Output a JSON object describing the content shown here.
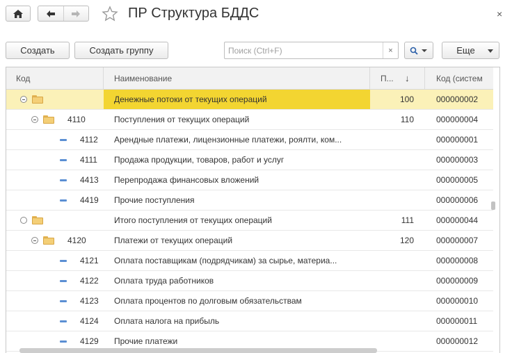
{
  "window": {
    "title": "ПР Структура БДДС",
    "close_label": "×"
  },
  "toolbar": {
    "create_label": "Создать",
    "create_group_label": "Создать группу",
    "search_placeholder": "Поиск (Ctrl+F)",
    "search_value": "",
    "clear_label": "×",
    "more_label": "Еще"
  },
  "table": {
    "columns": {
      "code": "Код",
      "name": "Наименование",
      "p": "П...",
      "sort_indicator": "↓",
      "system_code": "Код (систем"
    },
    "rows": [
      {
        "type": "group",
        "expander": "minus",
        "level": 0,
        "code": "",
        "name": "Денежные потоки от текущих операций",
        "p": "100",
        "system_code": "000000002",
        "selected": true
      },
      {
        "type": "group",
        "expander": "minus",
        "level": 1,
        "code": "4110",
        "name": "Поступления от текущих операций",
        "p": "110",
        "system_code": "000000004",
        "selected": false
      },
      {
        "type": "item",
        "level": 2,
        "code": "4112",
        "name": "Арендные платежи, лицензионные платежи, роялти, ком...",
        "p": "",
        "system_code": "000000001",
        "selected": false
      },
      {
        "type": "item",
        "level": 2,
        "code": "4111",
        "name": "Продажа продукции, товаров, работ и услуг",
        "p": "",
        "system_code": "000000003",
        "selected": false
      },
      {
        "type": "item",
        "level": 2,
        "code": "4413",
        "name": "Перепродажа финансовых вложений",
        "p": "",
        "system_code": "000000005",
        "selected": false
      },
      {
        "type": "item",
        "level": 2,
        "code": "4419",
        "name": "Прочие поступления",
        "p": "",
        "system_code": "000000006",
        "selected": false
      },
      {
        "type": "group",
        "expander": "empty",
        "level": 0,
        "code": "",
        "name": "Итого поступления от текущих операций",
        "p": "111",
        "system_code": "000000044",
        "selected": false
      },
      {
        "type": "group",
        "expander": "minus",
        "level": 1,
        "code": "4120",
        "name": "Платежи от текущих операций",
        "p": "120",
        "system_code": "000000007",
        "selected": false
      },
      {
        "type": "item",
        "level": 2,
        "code": "4121",
        "name": "Оплата поставщикам (подрядчикам) за сырье, материа...",
        "p": "",
        "system_code": "000000008",
        "selected": false
      },
      {
        "type": "item",
        "level": 2,
        "code": "4122",
        "name": "Оплата труда работников",
        "p": "",
        "system_code": "000000009",
        "selected": false
      },
      {
        "type": "item",
        "level": 2,
        "code": "4123",
        "name": "Оплата процентов по долговым обязательствам",
        "p": "",
        "system_code": "000000010",
        "selected": false
      },
      {
        "type": "item",
        "level": 2,
        "code": "4124",
        "name": "Оплата налога на прибыль",
        "p": "",
        "system_code": "000000011",
        "selected": false
      },
      {
        "type": "item",
        "level": 2,
        "code": "4129",
        "name": "Прочие платежи",
        "p": "",
        "system_code": "000000012",
        "selected": false
      }
    ]
  },
  "icons": {
    "home": "home-icon",
    "back": "arrow-left-icon",
    "forward": "arrow-right-icon",
    "favorite": "star-icon",
    "search": "search-icon",
    "folder": "folder-icon",
    "item": "item-dash-icon"
  },
  "colors": {
    "selected_row": "#fbf1b8",
    "selected_cell": "#f3d531",
    "folder": "#f4cf77",
    "item_marker": "#5b8fd3"
  }
}
